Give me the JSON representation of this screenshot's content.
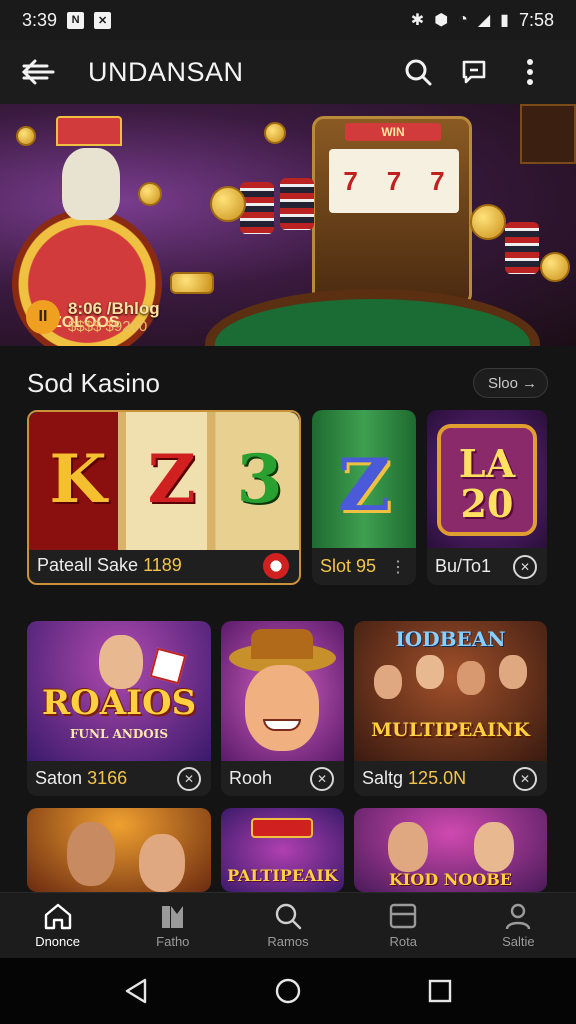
{
  "status": {
    "time": "3:39",
    "clock": "7:58"
  },
  "appbar": {
    "title": "UNDANSAN",
    "back_icon": "arrow-left-icon",
    "search_icon": "search-icon",
    "chat_icon": "chat-icon",
    "more_icon": "more-vertical-icon"
  },
  "banner": {
    "wheel_label": "ZOLOOS",
    "slot_sign": "WIN",
    "badge_icon": "II",
    "badge_line1": "8:06 /Bhlog",
    "badge_line2": "$$$$ $9200"
  },
  "section": {
    "title": "Sod Kasino",
    "see_more": "Sloo"
  },
  "row1": [
    {
      "art": "K Z 3",
      "label": "Pateall Sake",
      "num": "1189",
      "icon": "chip-icon"
    },
    {
      "art": "Z",
      "label": "Slot 95",
      "num": "",
      "icon": "more-vertical-icon"
    },
    {
      "art": "LA 20",
      "label": "Bu/To1",
      "num": "",
      "icon": "close-circle-icon"
    }
  ],
  "row2": [
    {
      "art": "ROAIOS",
      "art_sub": "FUNL ANDOIS",
      "label": "Saton",
      "num": "3166",
      "icon": "close-circle-icon"
    },
    {
      "art": "",
      "art_sub": "",
      "label": "Rooh",
      "num": "",
      "icon": "close-circle-icon"
    },
    {
      "art": "MULTIPEAINK",
      "art_sub": "IODBEAN",
      "label": "Saltg",
      "num": "125.0N",
      "icon": "close-circle-icon"
    }
  ],
  "row3": [
    {
      "art": ""
    },
    {
      "art": "PALTIPEAIK"
    },
    {
      "art": "KIOD NOOBE"
    }
  ],
  "bottomnav": [
    {
      "label": "Dnonce",
      "icon": "home-icon",
      "active": true
    },
    {
      "label": "Fatho",
      "icon": "cards-icon",
      "active": false
    },
    {
      "label": "Ramos",
      "icon": "search-icon",
      "active": false
    },
    {
      "label": "Rota",
      "icon": "wallet-icon",
      "active": false
    },
    {
      "label": "Saltie",
      "icon": "profile-icon",
      "active": false
    }
  ],
  "colors": {
    "accent": "#f5c54a",
    "background": "#141414",
    "card": "#1f1f1f"
  }
}
